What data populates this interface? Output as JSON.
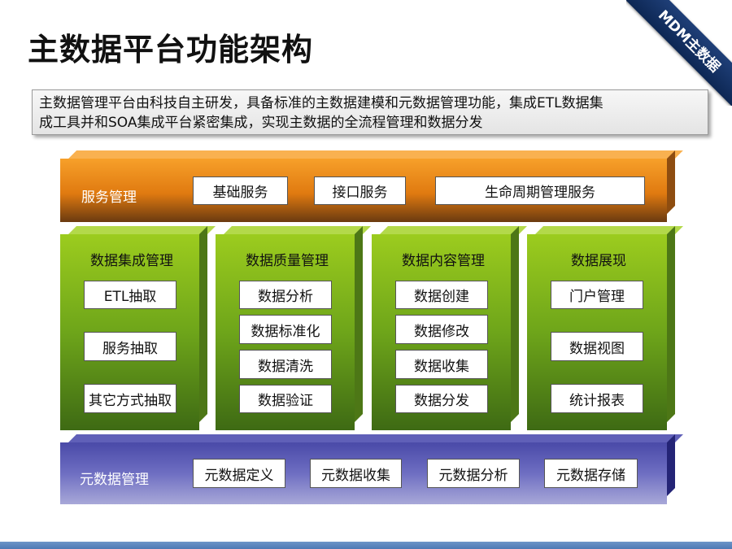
{
  "title": "主数据平台功能架构",
  "corner_badge": "MDM主数据",
  "description": {
    "line1": "主数据管理平台由科技自主研发，具备标准的主数据建模和元数据管理功能，集成ETL数据集",
    "line2": "成工具并和SOA集成平台紧密集成，实现主数据的全流程管理和数据分发"
  },
  "service_layer": {
    "label": "服务管理",
    "items": [
      "基础服务",
      "接口服务",
      "生命周期管理服务"
    ]
  },
  "columns": [
    {
      "title": "数据集成管理",
      "items": [
        "ETL抽取",
        "服务抽取",
        "其它方式抽取"
      ]
    },
    {
      "title": "数据质量管理",
      "items": [
        "数据分析",
        "数据标准化",
        "数据清洗",
        "数据验证"
      ]
    },
    {
      "title": "数据内容管理",
      "items": [
        "数据创建",
        "数据修改",
        "数据收集",
        "数据分发"
      ]
    },
    {
      "title": "数据展现",
      "items": [
        "门户管理",
        "数据视图",
        "统计报表"
      ]
    }
  ],
  "meta_layer": {
    "label": "元数据管理",
    "items": [
      "元数据定义",
      "元数据收集",
      "元数据分析",
      "元数据存储"
    ]
  },
  "colors": {
    "service": "#e07a10",
    "green": "#6ea51a",
    "meta": "#4a4aa8",
    "badge": "#1f3f78"
  }
}
